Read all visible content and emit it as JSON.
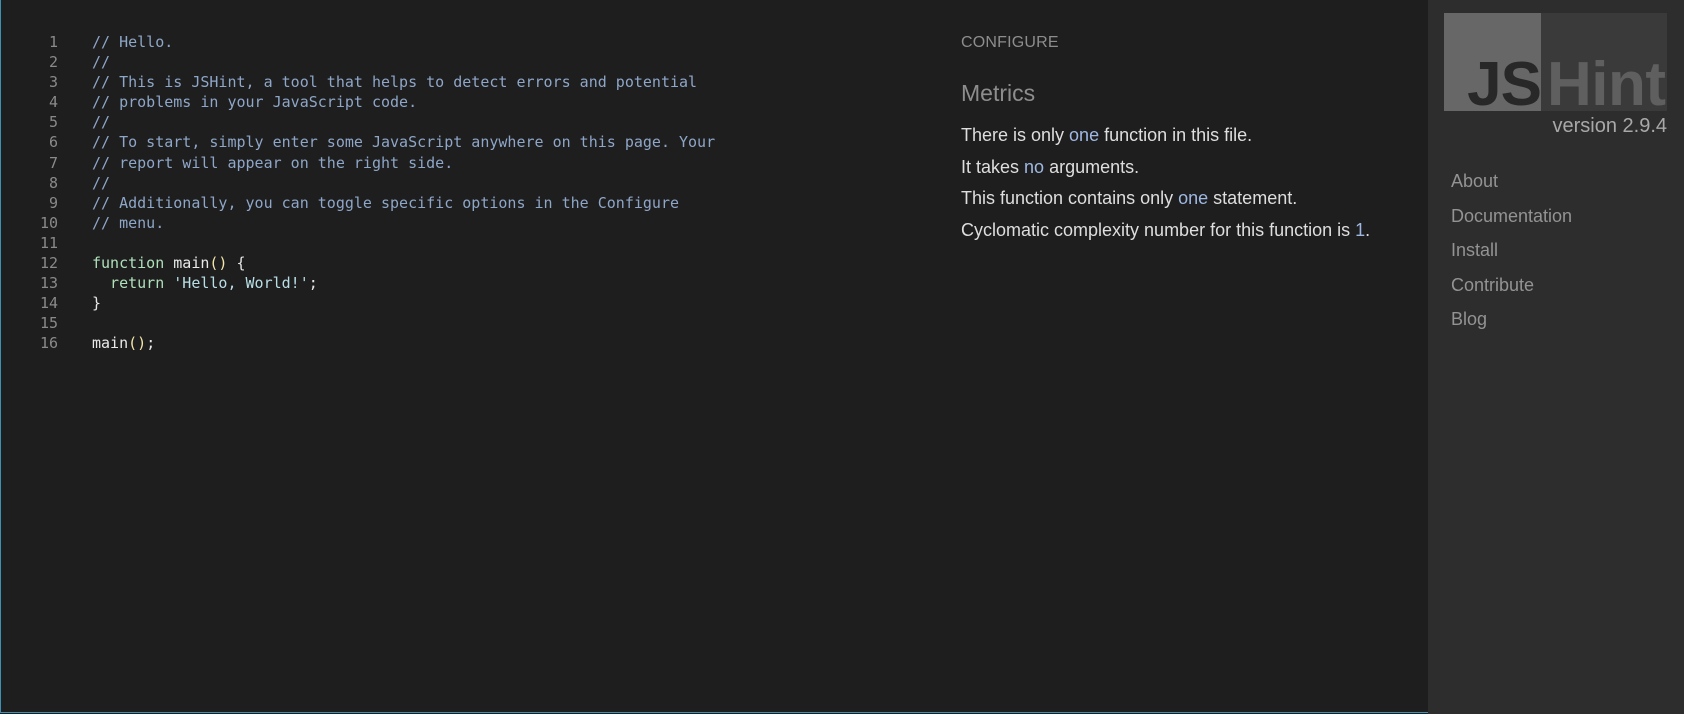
{
  "editor": {
    "lines": [
      {
        "num": "1",
        "tokens": [
          {
            "t": "// Hello.",
            "k": "comment"
          }
        ]
      },
      {
        "num": "2",
        "tokens": [
          {
            "t": "//",
            "k": "comment"
          }
        ]
      },
      {
        "num": "3",
        "tokens": [
          {
            "t": "// This is JSHint, a tool that helps to detect errors and potential",
            "k": "comment"
          }
        ]
      },
      {
        "num": "4",
        "tokens": [
          {
            "t": "// problems in your JavaScript code.",
            "k": "comment"
          }
        ]
      },
      {
        "num": "5",
        "tokens": [
          {
            "t": "//",
            "k": "comment"
          }
        ]
      },
      {
        "num": "6",
        "tokens": [
          {
            "t": "// To start, simply enter some JavaScript anywhere on this page. Your",
            "k": "comment"
          }
        ]
      },
      {
        "num": "7",
        "tokens": [
          {
            "t": "// report will appear on the right side.",
            "k": "comment"
          }
        ]
      },
      {
        "num": "8",
        "tokens": [
          {
            "t": "//",
            "k": "comment"
          }
        ]
      },
      {
        "num": "9",
        "tokens": [
          {
            "t": "// Additionally, you can toggle specific options in the Configure",
            "k": "comment"
          }
        ]
      },
      {
        "num": "10",
        "tokens": [
          {
            "t": "// menu.",
            "k": "comment"
          }
        ]
      },
      {
        "num": "11",
        "tokens": []
      },
      {
        "num": "12",
        "tokens": [
          {
            "t": "function",
            "k": "keyword"
          },
          {
            "t": " main",
            "k": "ident"
          },
          {
            "t": "()",
            "k": "paren"
          },
          {
            "t": " {",
            "k": "punct"
          }
        ]
      },
      {
        "num": "13",
        "tokens": [
          {
            "t": "  return",
            "k": "keyword"
          },
          {
            "t": " 'Hello, World!'",
            "k": "string"
          },
          {
            "t": ";",
            "k": "punct"
          }
        ]
      },
      {
        "num": "14",
        "tokens": [
          {
            "t": "}",
            "k": "punct"
          }
        ]
      },
      {
        "num": "15",
        "tokens": []
      },
      {
        "num": "16",
        "tokens": [
          {
            "t": "main",
            "k": "ident"
          },
          {
            "t": "()",
            "k": "paren"
          },
          {
            "t": ";",
            "k": "punct"
          }
        ]
      }
    ]
  },
  "report": {
    "configure_label": "CONFIGURE",
    "metrics_title": "Metrics",
    "metrics": [
      [
        {
          "t": "There is only "
        },
        {
          "t": "one",
          "hl": true
        },
        {
          "t": " function in this file."
        }
      ],
      [
        {
          "t": "It takes "
        },
        {
          "t": "no",
          "hl": true
        },
        {
          "t": " arguments."
        }
      ],
      [
        {
          "t": "This function contains only "
        },
        {
          "t": "one",
          "hl": true
        },
        {
          "t": " statement."
        }
      ],
      [
        {
          "t": "Cyclomatic complexity number for this function is "
        },
        {
          "t": "1",
          "hl": true
        },
        {
          "t": "."
        }
      ]
    ]
  },
  "sidebar": {
    "logo_js": "JS",
    "logo_hint": "Hint",
    "version": "version 2.9.4",
    "nav": [
      {
        "label": "About",
        "name": "nav-about"
      },
      {
        "label": "Documentation",
        "name": "nav-documentation"
      },
      {
        "label": "Install",
        "name": "nav-install"
      },
      {
        "label": "Contribute",
        "name": "nav-contribute"
      },
      {
        "label": "Blog",
        "name": "nav-blog"
      }
    ]
  },
  "colors": {
    "background": "#1e1e1e",
    "sidebar": "#2d2d2d",
    "comment": "#8ea6c8",
    "keyword": "#aee0ba",
    "string": "#b8dfe6",
    "highlight": "#9fb8e3",
    "frame_border": "#3d8fb4"
  }
}
